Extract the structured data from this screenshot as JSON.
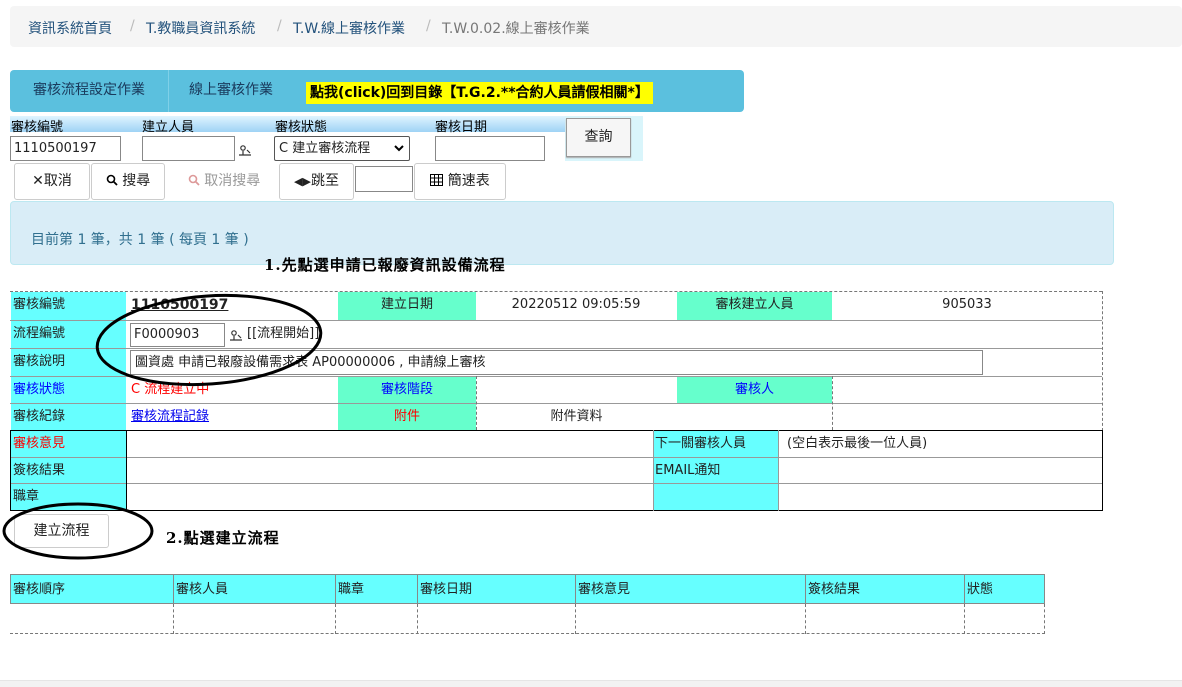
{
  "breadcrumb": {
    "items": [
      "資訊系統首頁",
      "T.教職員資訊系統",
      "T.W.線上審核作業"
    ],
    "current": "T.W.0.02.線上審核作業",
    "separator": "/"
  },
  "tabs": {
    "items": [
      "審核流程設定作業",
      "線上審核作業"
    ],
    "link_label": "點我(click)回到目錄【T.G.2.**合約人員請假相關*】"
  },
  "query": {
    "labels": {
      "id": "審核編號",
      "creator": "建立人員",
      "status": "審核狀態",
      "date": "審核日期"
    },
    "id_value": "1110500197",
    "creator_value": "",
    "status_selected": "C 建立審核流程",
    "date_value": "",
    "button_label": "查詢"
  },
  "toolbar": {
    "cancel": "取消",
    "search": "搜尋",
    "cancel_search": "取消搜尋",
    "goto": "跳至",
    "goto_value": "",
    "brief_table": "簡速表"
  },
  "record_info": "目前第 1 筆，共 1 筆 ( 每頁 1 筆 )",
  "annotations": {
    "step1": "1.先點選申請已報廢資訊設備流程",
    "step2": "2.點選建立流程"
  },
  "form": {
    "review_id_label": "審核編號",
    "review_id_value": "1110500197",
    "create_date_label": "建立日期",
    "create_date_value": "20220512 09:05:59",
    "creator_label": "審核建立人員",
    "creator_value": "905033",
    "flow_id_label": "流程編號",
    "flow_id_value": "F0000903",
    "flow_start_text": "[[流程開始]]",
    "desc_label": "審核說明",
    "desc_value": "圖資處 申請已報廢設備需求表  AP00000006 , 申請線上審核",
    "status_label": "審核狀態",
    "status_value": "C 流程建立中",
    "stage_label": "審核階段",
    "stage_value": "",
    "reviewer_label": "審核人",
    "reviewer_value": "",
    "log_label": "審核紀錄",
    "log_link": "審核流程記錄",
    "attach_label": "附件",
    "attach_value": "附件資料",
    "opinion_label": "審核意見",
    "next_reviewer_label": "下一關審核人員",
    "next_reviewer_hint": "(空白表示最後一位人員)",
    "result_label": "簽核結果",
    "email_label": "EMAIL通知",
    "title_label": "職章"
  },
  "create_flow_button": "建立流程",
  "history_table": {
    "columns": [
      "審核順序",
      "審核人員",
      "職章",
      "審核日期",
      "審核意見",
      "簽核結果",
      "狀態"
    ]
  },
  "colors": {
    "label_cyan": "#66ffff",
    "label_green": "#66ffcc",
    "tab_bg": "#5bc0de",
    "link_highlight": "#ffff00",
    "info_bg": "#d9edf7",
    "alert_red": "#ff0000",
    "link_blue": "#0000ff"
  }
}
